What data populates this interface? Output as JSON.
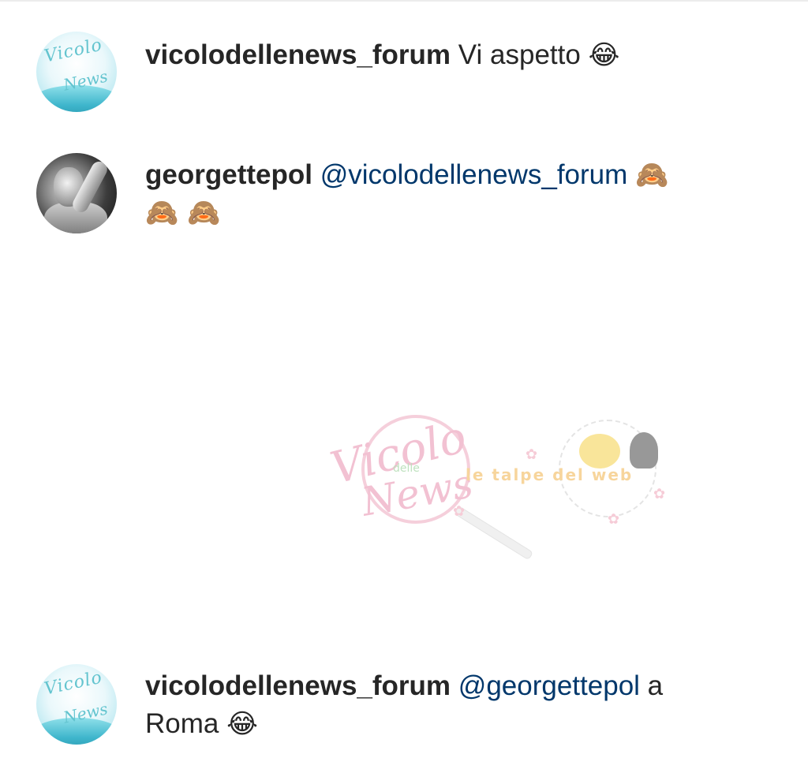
{
  "comments": [
    {
      "username": "vicolodellenews_forum",
      "text": "Vi aspetto",
      "emoji": "😂"
    },
    {
      "username": "georgettepol",
      "mention": "@vicolodellenews_forum",
      "emoji": "🙈",
      "emoji2": "🙈 🙈"
    },
    {
      "username": "vicolodellenews_forum",
      "mention": "@georgettepol",
      "text": "a Roma",
      "emoji": "😂"
    }
  ],
  "watermark": {
    "logo_line1": "Vicolo",
    "logo_small": "delle",
    "logo_line2": "News",
    "tagline": "le talpe del web"
  },
  "avatars": {
    "forum_logo_top": "Vicolo",
    "forum_logo_bottom": "News"
  },
  "colors": {
    "text": "#262626",
    "mention": "#00376b",
    "watermark_pink": "#e88fae"
  }
}
